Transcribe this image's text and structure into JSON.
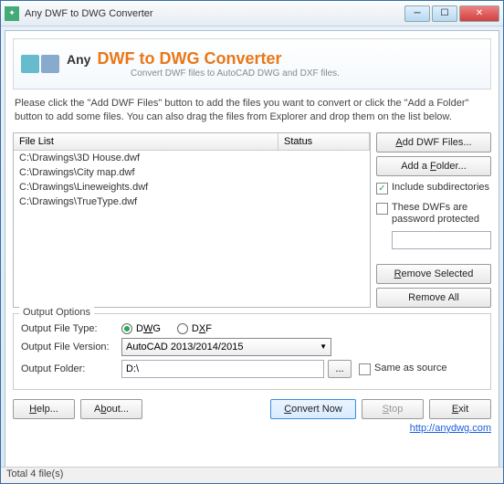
{
  "window": {
    "title": "Any DWF to DWG Converter"
  },
  "header": {
    "any": "Any",
    "main": "DWF to DWG Converter",
    "subtitle": "Convert DWF files to AutoCAD DWG and DXF files."
  },
  "intro": "Please click the \"Add DWF Files\" button to add the files you want to convert or click the \"Add a Folder\" button to add some files. You can also drag the files from Explorer and drop them on the list below.",
  "filelist": {
    "col1": "File List",
    "col2": "Status",
    "rows": [
      "C:\\Drawings\\3D House.dwf",
      "C:\\Drawings\\City map.dwf",
      "C:\\Drawings\\Lineweights.dwf",
      "C:\\Drawings\\TrueType.dwf"
    ]
  },
  "side": {
    "add_files": "Add DWF Files...",
    "add_folder": "Add a Folder...",
    "include_sub": "Include subdirectories",
    "pwd_protected": "These DWFs are password protected",
    "remove_selected": "Remove Selected",
    "remove_all": "Remove All"
  },
  "output": {
    "group": "Output Options",
    "type_label": "Output File Type:",
    "dwg": "DWG",
    "dxf": "DXF",
    "version_label": "Output File Version:",
    "version_value": "AutoCAD 2013/2014/2015",
    "folder_label": "Output Folder:",
    "folder_value": "D:\\",
    "browse": "...",
    "same_as_source": "Same as source"
  },
  "bottom": {
    "help": "Help...",
    "about": "About...",
    "convert": "Convert Now",
    "stop": "Stop",
    "exit": "Exit",
    "link": "http://anydwg.com"
  },
  "status": "Total 4 file(s)"
}
